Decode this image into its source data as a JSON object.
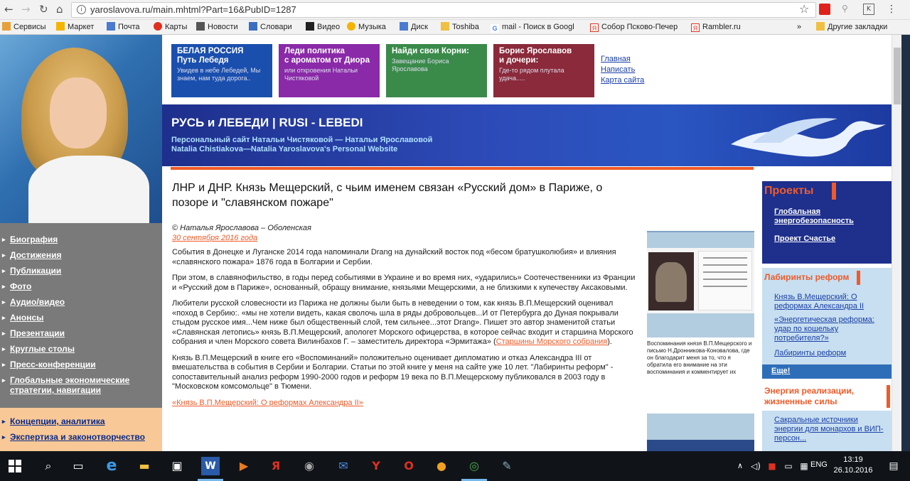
{
  "browser": {
    "url": "yaroslavova.ru/main.mhtml?Part=16&PubID=1287",
    "bookmarks": [
      "Сервисы",
      "Маркет",
      "Почта",
      "Карты",
      "Новости",
      "Словари",
      "Видео",
      "Музыка",
      "Диск",
      "Toshiba",
      "mail - Поиск в Googl",
      "Собор Псково-Печер",
      "Rambler.ru",
      "Другие закладки"
    ],
    "bookmarks_more": "»"
  },
  "header": {
    "tiles": [
      {
        "title1": "БЕЛАЯ РОССИЯ",
        "title2": "Путь Лебедя",
        "text": "Увидев в небе Лебедей, Мы знаем, нам туда дорога..",
        "color": "#1a4fae"
      },
      {
        "title1": "Леди политика",
        "title2": "с ароматом от Диора",
        "text": "или откровения Натальи Чистяковой",
        "color": "#8a2aa8"
      },
      {
        "title1": "Найди свои Корни:",
        "title2": "",
        "text": "Завещание Бориса Ярославова",
        "color": "#3a8a4a"
      },
      {
        "title1": "Борис Ярославов",
        "title2": "и дочери:",
        "text": "Где-то рядом плутала удача.....",
        "color": "#8a2a3a"
      }
    ],
    "links": [
      "Главная",
      "Написать",
      "Карта сайта"
    ],
    "site_title": "РУСЬ и ЛЕБЕДИ | RUSI - LEBEDI",
    "site_sub1": "Персональный сайт Натальи Чистяковой — Натальи Ярославовой",
    "site_sub2": "Natalia Chistiakova—Natalia Yaroslavova's  Personal Website"
  },
  "nav": {
    "items": [
      "Биография",
      "Достижения",
      "Публикации",
      "Фото",
      "Аудио/видео",
      "Анонсы",
      "Презентации",
      "Круглые столы",
      "Пресс-конференции",
      "Глобальные экономические стратегии, навигации"
    ],
    "items2": [
      "Концепции, аналитика",
      "Экспертиза и законотворчество"
    ]
  },
  "article": {
    "title": "ЛНР и ДНР. Князь Мещерский, с чьим именем связан «Русский дом» в Париже, о позоре и \"славянском пожаре\"",
    "author": "© Наталья Ярославова – Оболенская",
    "date": "30 сентября 2016 года",
    "p1": "События в Донецке и Луганске 2014 года напоминали Drang на дунайский восток под «бесом братушколюбия» и влияния «славянского пожара» 1876 года в Болгарии и Сербии.",
    "p2": "При этом, в славянофильство, в годы перед событиями в Украине и во время них, «ударились» Соотечественники из Франции и «Русский дом в Париже», основанный, обращу внимание, князьями Мещерскими, а не близкими к купечеству Аксаковыми.",
    "p3": "Любители русской словесности из Парижа не должны были быть в неведении о том, как князь В.П.Мещерский оценивал «поход в Сербию:. «мы не хотели видеть, какая сволочь шла в ряды добровольцев...И от Петербурга до Дуная покрывали стыдом русское имя...Чем ниже был общественный слой, тем сильнее...этот Drang». Пишет это автор знаменитой статьи «Славянская летопись» князь В.П.Мещерский, апологет Морского офицерства, в которое сейчас входит и старшина Морского собрания и член Морского совета Вилинбахов Г. – заместитель директора «Эрмитажа» (",
    "p3_link": "Старшины Морского собрания",
    "p3_end": ").",
    "p4": "Князь В.П.Мещерский в книге его «Воспоминаний» положительно оценивает дипломатию и отказ Александра III от вмешательства в события в Сербии и Болгарии. Статьи по этой книге у меня на сайте уже 10 лет. \"Лабиринты реформ\" - сопоставительный анализ реформ 1990-2000 годов и реформ 19 века по В.П.Мещерскому публиковался в 2003 году в \"Московском комсомольце\" в Тюмени.",
    "link_bottom": "«Князь В.П.Мещерский: О реформах Александра II»",
    "caption": "Воспоминания князя В.П.Мещерского и письмо Н.Дронникова-Коновалова, где он благодарит меня за то, что я обратила его внимание на эти воспоминания и комментирует их"
  },
  "right": {
    "projects_title": "Проекты",
    "projects": [
      "Глобальная энергобезопасность",
      "Проект Счастье"
    ],
    "lab_title": "Лабиринты реформ",
    "lab_links": [
      "Князь В.Мещерский: О реформах Александра II",
      "«Энергетическая реформа: удар по кошельку потребителя?»",
      "Лабиринты реформ"
    ],
    "more": "Еще!",
    "energy_title": "Энергия реализации, жизненные силы",
    "energy_link": "Сакральные источники энергии для монархов и ВИП-персон..."
  },
  "taskbar": {
    "time": "13:19",
    "date": "26.10.2016",
    "lang": "ENG"
  }
}
